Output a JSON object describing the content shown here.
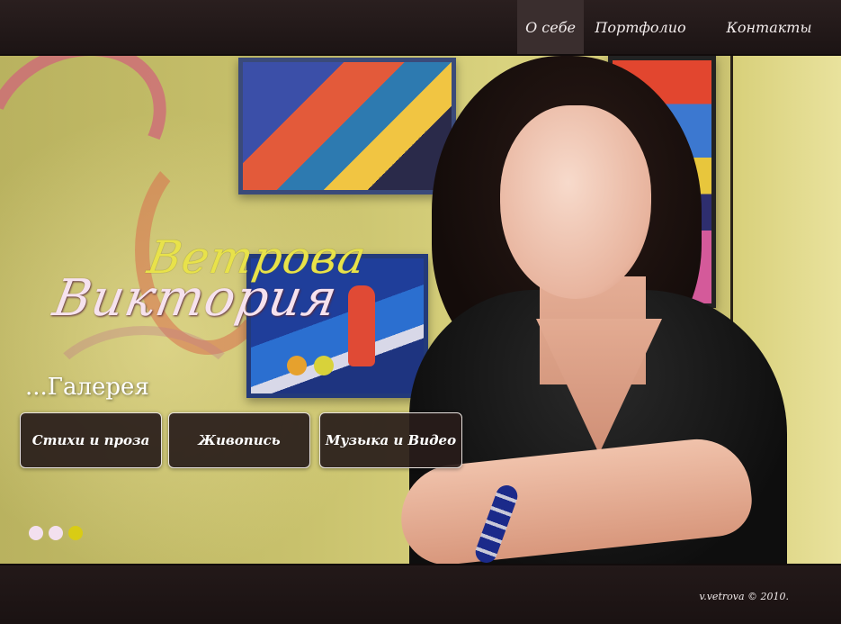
{
  "nav": {
    "items": [
      {
        "label": "О себе",
        "active": true
      },
      {
        "label": "Портфолио",
        "active": false
      },
      {
        "label": "Контакты",
        "active": false
      }
    ]
  },
  "hero": {
    "logo": {
      "line1": "Ветрова",
      "line2": "Виктория"
    },
    "gallery_title": "...Галерея",
    "buttons": [
      "Стихи и проза",
      "Живопись",
      "Музыка и Видео"
    ],
    "slider": {
      "count": 3,
      "active_index": 2
    },
    "colors": {
      "dot_active": "#d9cc14",
      "dot_inactive": "#f3e0ef",
      "logo_yellow": "#e8e24a",
      "logo_pink": "#f6e2ee"
    }
  },
  "footer": {
    "copyright": "v.vetrova © 2010."
  }
}
